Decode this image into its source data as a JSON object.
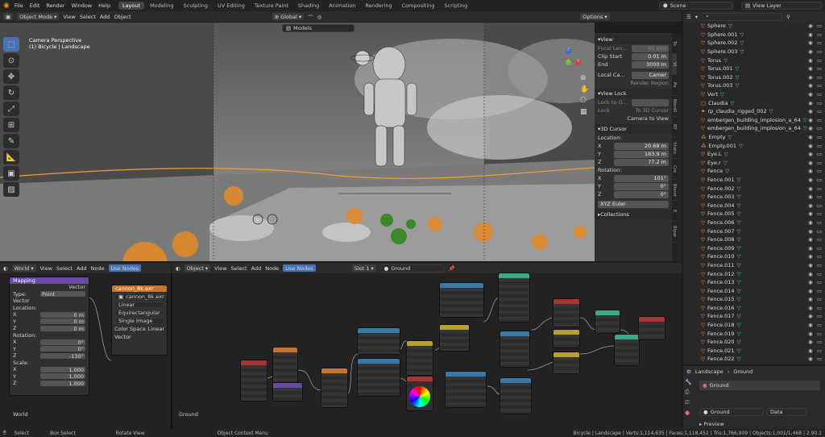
{
  "topbar": {
    "menus": [
      "File",
      "Edit",
      "Render",
      "Window",
      "Help"
    ],
    "workspaces": [
      "Layout",
      "Modeling",
      "Sculpting",
      "UV Editing",
      "Texture Paint",
      "Shading",
      "Animation",
      "Rendering",
      "Compositing",
      "Scripting"
    ],
    "active_workspace": "Layout",
    "scene": "Scene",
    "view_layer": "View Layer"
  },
  "viewport": {
    "mode": "Object Mode",
    "menus": [
      "View",
      "Select",
      "Add",
      "Object"
    ],
    "transform": "Global",
    "models": "Models",
    "options": "Options",
    "overlay_title": "Camera Perspective",
    "overlay_sub": "(1) Bicycle | Landscape",
    "gizmo": {
      "x": "X",
      "y": "Y",
      "z": "Z"
    }
  },
  "npanel": {
    "view_title": "View",
    "focal_label": "Focal Len...",
    "focal_value": "50 mm",
    "clip_start_label": "Clip Start",
    "clip_start": "0.01 m",
    "end_label": "End",
    "end": "3000 m",
    "local_camera_label": "Local Ca...",
    "camera_field": "Camer",
    "render_region": "Render Region",
    "view_lock_title": "View Lock",
    "lock_to_object": "Lock to O...",
    "lock_label": "Lock",
    "to_3d_cursor": "To 3D Cursor",
    "camera_to_view": "Camera to View",
    "cursor_title": "3D Cursor",
    "location_label": "Location:",
    "loc_x": "20.68 m",
    "loc_y": "183.9 m",
    "loc_z": "77.2 m",
    "rotation_label": "Rotation:",
    "rot_x": "101°",
    "rot_y": "0°",
    "rot_z": "0°",
    "rotation_mode": "XYZ Euler",
    "collections_title": "Collections",
    "tabs": [
      "To",
      "Vi",
      "Po",
      "BlenD",
      "RT",
      "Static",
      "Cre",
      "Blend",
      "E",
      "Blpar",
      "Rete",
      "Hard",
      "polyq"
    ]
  },
  "outliner": {
    "rows": [
      {
        "name": "Sphere",
        "type": "mesh"
      },
      {
        "name": "Sphere.001",
        "type": "mesh"
      },
      {
        "name": "Sphere.002",
        "type": "mesh"
      },
      {
        "name": "Sphere.003",
        "type": "mesh"
      },
      {
        "name": "Torus",
        "type": "mesh"
      },
      {
        "name": "Torus.001",
        "type": "mesh"
      },
      {
        "name": "Torus.002",
        "type": "mesh"
      },
      {
        "name": "Torus.003",
        "type": "mesh"
      },
      {
        "name": "Vert",
        "type": "mesh"
      },
      {
        "name": "Claudia",
        "type": "collection"
      },
      {
        "name": "rp_claudia_rigged_002",
        "type": "armature"
      },
      {
        "name": "embergen_building_implosion_a_64",
        "type": "mesh"
      },
      {
        "name": "embergen_building_implosion_a_64",
        "type": "mesh"
      },
      {
        "name": "Empty",
        "type": "empty"
      },
      {
        "name": "Empty.001",
        "type": "empty"
      },
      {
        "name": "Eye.L",
        "type": "mesh"
      },
      {
        "name": "Eye.r",
        "type": "mesh"
      },
      {
        "name": "Fence",
        "type": "mesh"
      },
      {
        "name": "Fence.001",
        "type": "mesh"
      },
      {
        "name": "Fence.002",
        "type": "mesh"
      },
      {
        "name": "Fence.003",
        "type": "mesh"
      },
      {
        "name": "Fence.004",
        "type": "mesh"
      },
      {
        "name": "Fence.005",
        "type": "mesh"
      },
      {
        "name": "Fence.006",
        "type": "mesh"
      },
      {
        "name": "Fence.007",
        "type": "mesh"
      },
      {
        "name": "Fence.008",
        "type": "mesh"
      },
      {
        "name": "Fence.009",
        "type": "mesh"
      },
      {
        "name": "Fence.010",
        "type": "mesh"
      },
      {
        "name": "Fence.011",
        "type": "mesh"
      },
      {
        "name": "Fence.012",
        "type": "mesh"
      },
      {
        "name": "Fence.013",
        "type": "mesh"
      },
      {
        "name": "Fence.014",
        "type": "mesh"
      },
      {
        "name": "Fence.015",
        "type": "mesh"
      },
      {
        "name": "Fence.016",
        "type": "mesh"
      },
      {
        "name": "Fence.017",
        "type": "mesh"
      },
      {
        "name": "Fence.018",
        "type": "mesh"
      },
      {
        "name": "Fence.019",
        "type": "mesh"
      },
      {
        "name": "Fence.020",
        "type": "mesh"
      },
      {
        "name": "Fence.021",
        "type": "mesh"
      },
      {
        "name": "Fence.022",
        "type": "mesh"
      }
    ]
  },
  "props": {
    "breadcrumb_a": "Landscape",
    "breadcrumb_b": "Ground",
    "slot": "Ground",
    "material_field": "Ground",
    "data_select": "Data",
    "preview": "Preview"
  },
  "world_editor": {
    "type": "World",
    "menus": [
      "View",
      "Select",
      "Add",
      "Node"
    ],
    "use_nodes": "Use Nodes",
    "label": "World",
    "mapping": {
      "title": "Mapping",
      "vector": "Vector",
      "type_label": "Type:",
      "type_value": "Point",
      "vector_in": "Vector",
      "location": "Location:",
      "loc": [
        "0 m",
        "0 m",
        "0 m"
      ],
      "rotation": "Rotation:",
      "rot": [
        "0°",
        "0°",
        "-130°"
      ],
      "scale": "Scale:",
      "scl": [
        "1.000",
        "1.000",
        "1.000"
      ],
      "axes": [
        "X",
        "Y",
        "Z"
      ]
    },
    "env": {
      "title": "cannon_8k.exr",
      "file": "cannon_8k.exr",
      "linear": "Linear",
      "equirect": "Equirectangular",
      "single": "Single Image",
      "colorspace_label": "Color Space",
      "colorspace": "Linear",
      "vector": "Vector"
    }
  },
  "shader_editor": {
    "type": "Object",
    "menus": [
      "View",
      "Select",
      "Add",
      "Node"
    ],
    "use_nodes": "Use Nodes",
    "slot": "Slot 1",
    "material": "Ground",
    "label": "Ground"
  },
  "statusbar": {
    "select": "Select",
    "box_select": "Box Select",
    "rotate": "Rotate View",
    "context": "Object Context Menu",
    "stats": "Bicycle | Landscape | Verts:1,114,635 | Faces:1,118,452 | Tris:1,766,909 | Objects:1,001/1,468 | 2.90.1"
  },
  "colors": {
    "accent": "#4772b3",
    "orange": "#f0a030",
    "mesh_green": "#5fc7a1"
  }
}
